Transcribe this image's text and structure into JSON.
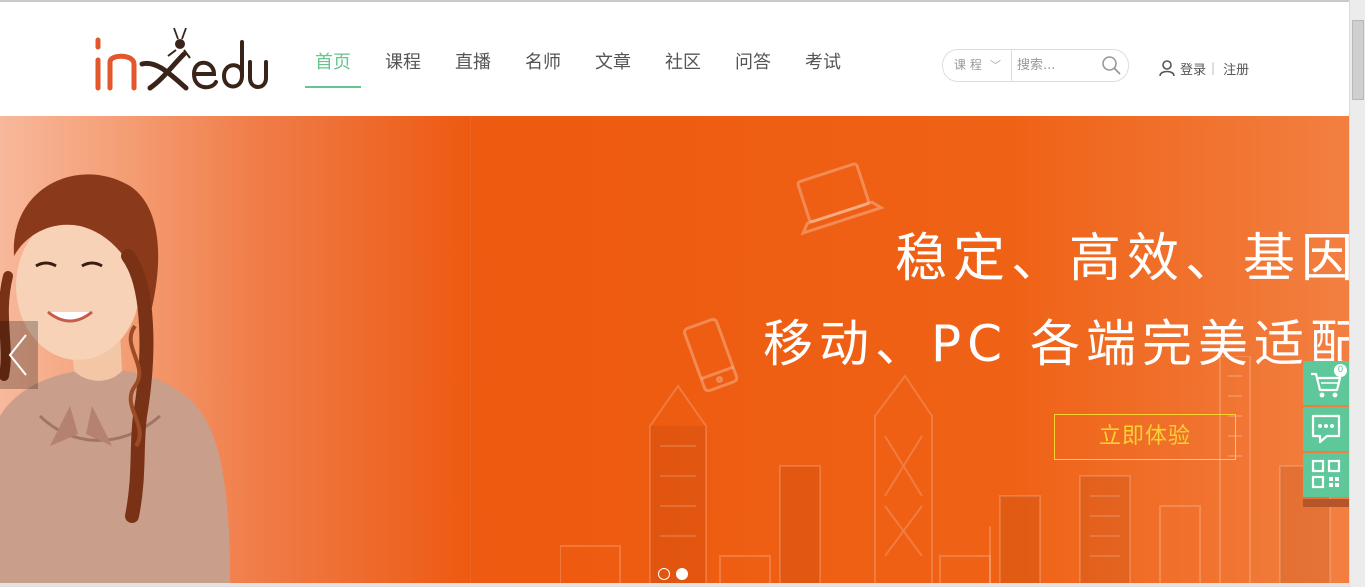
{
  "site": {
    "logo_text": "inxedu"
  },
  "nav": {
    "items": [
      {
        "label": "首页",
        "active": true
      },
      {
        "label": "课程"
      },
      {
        "label": "直播"
      },
      {
        "label": "名师"
      },
      {
        "label": "文章"
      },
      {
        "label": "社区"
      },
      {
        "label": "问答"
      },
      {
        "label": "考试"
      }
    ]
  },
  "search": {
    "category": "课 程",
    "placeholder": "搜索..."
  },
  "account": {
    "login": "登录",
    "register": "注册"
  },
  "banner": {
    "headline1": "稳定、高效、基因优",
    "headline2": "移动、PC 各端完美适配，",
    "cta": "立即体验",
    "slides": 2,
    "active_slide": 2
  },
  "side_tools": {
    "cart_count": "0"
  },
  "colors": {
    "brand_green": "#68c48e",
    "banner_orange": "#ee5a10",
    "cta_yellow": "#f6d233",
    "logo_red": "#e2572b"
  }
}
